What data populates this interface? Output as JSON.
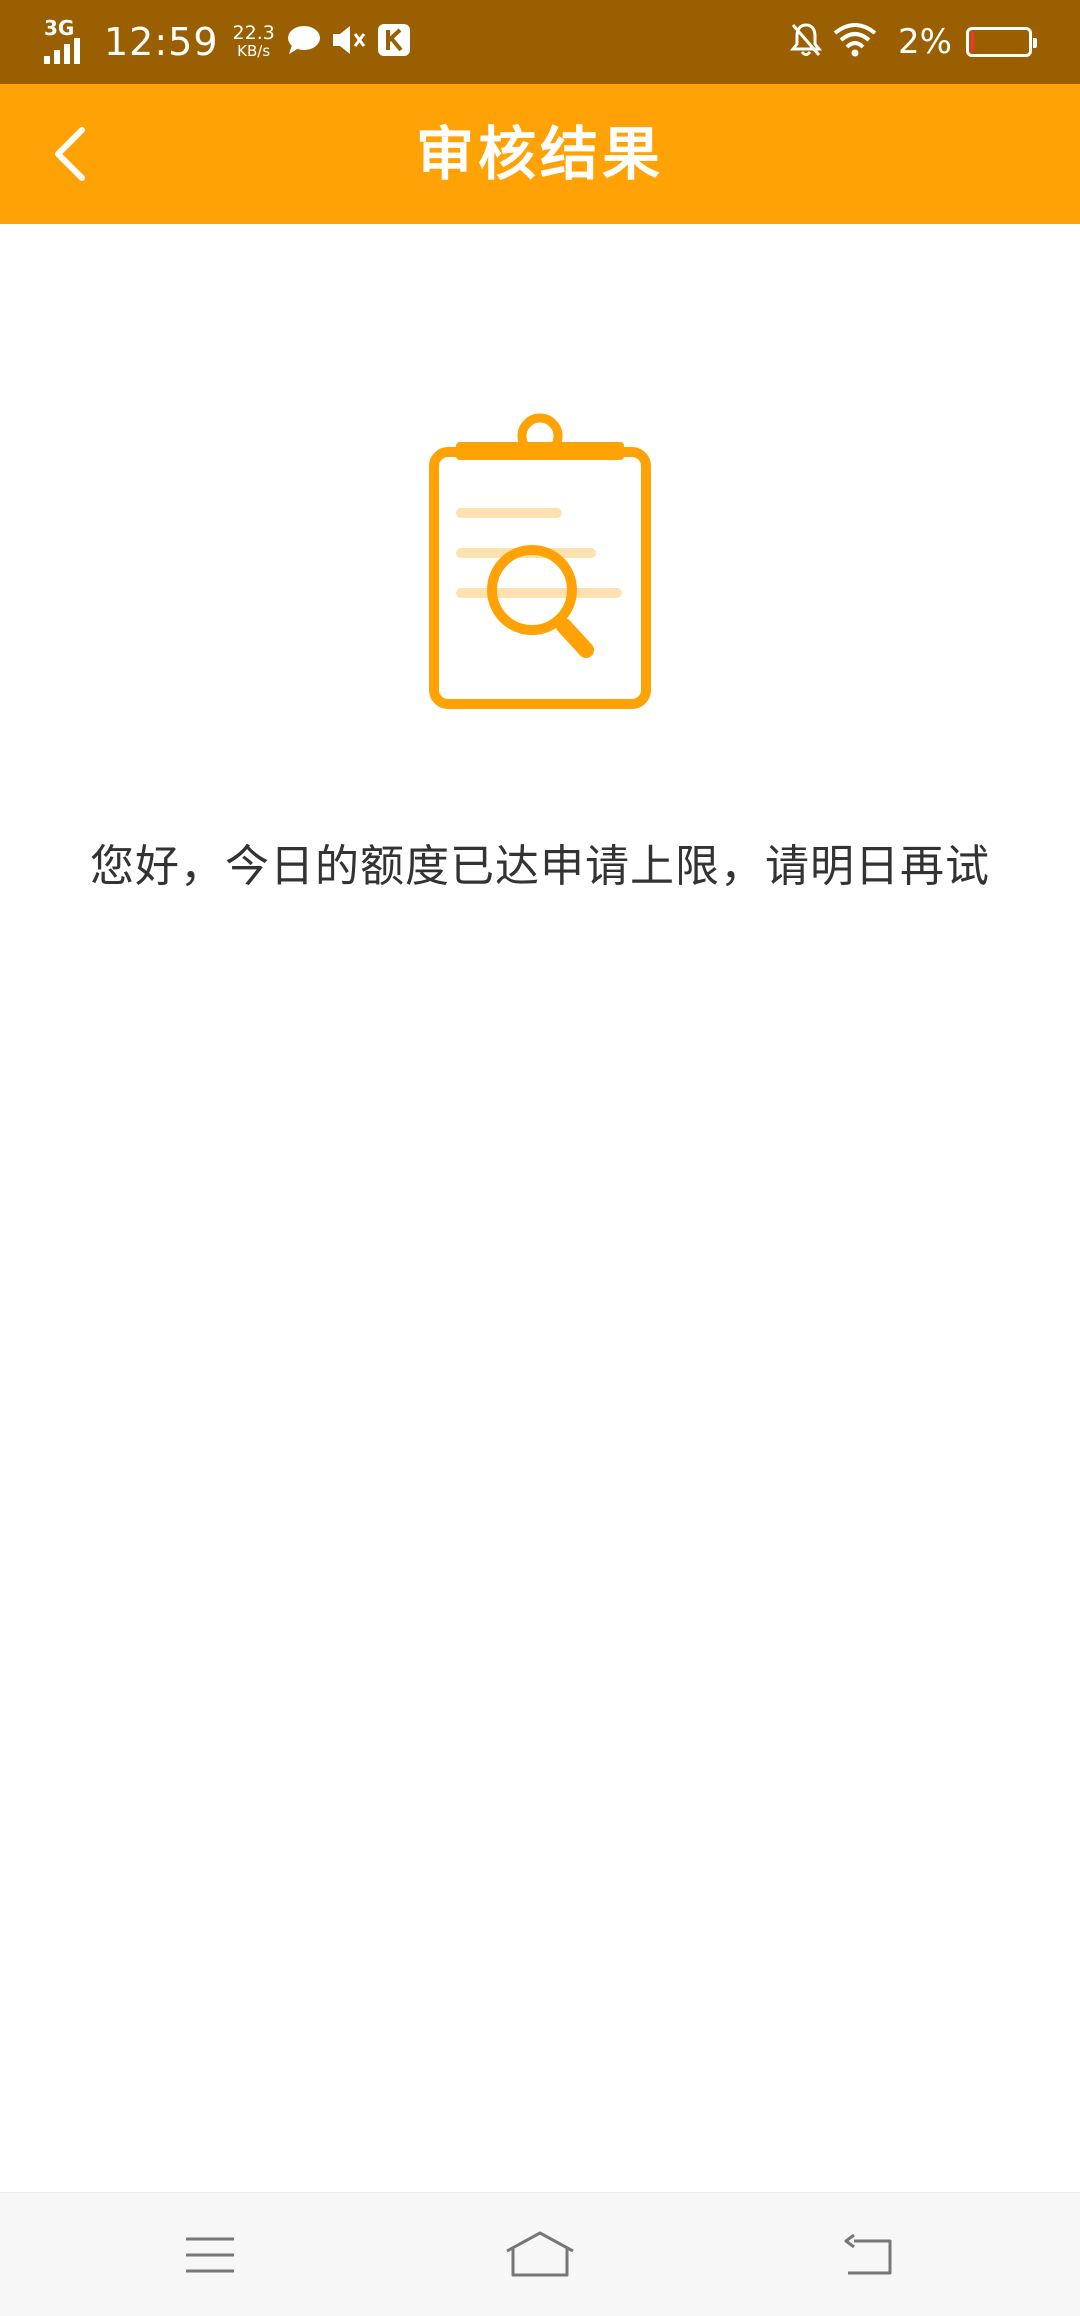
{
  "status_bar": {
    "network": "3G",
    "time": "12:59",
    "speed_value": "22.3",
    "speed_unit": "KB/s",
    "battery": "2%",
    "battery_level": 0.02,
    "icons": [
      "signal-icon",
      "chat-bubble-icon",
      "mute-icon",
      "k-app-icon",
      "bell-off-icon",
      "wifi-icon",
      "battery-icon"
    ]
  },
  "header": {
    "title": "审核结果",
    "back_icon": "chevron-left-icon"
  },
  "main": {
    "illustration_icon": "clipboard-search-icon",
    "message": "您好，今日的额度已达申请上限，请明日再试"
  },
  "nav_bar": {
    "icons": [
      "menu-icon",
      "home-icon",
      "back-icon"
    ]
  },
  "colors": {
    "status_bar": "#9a5f00",
    "accent": "#ffa205",
    "background": "#ffffff",
    "text": "#333333"
  }
}
